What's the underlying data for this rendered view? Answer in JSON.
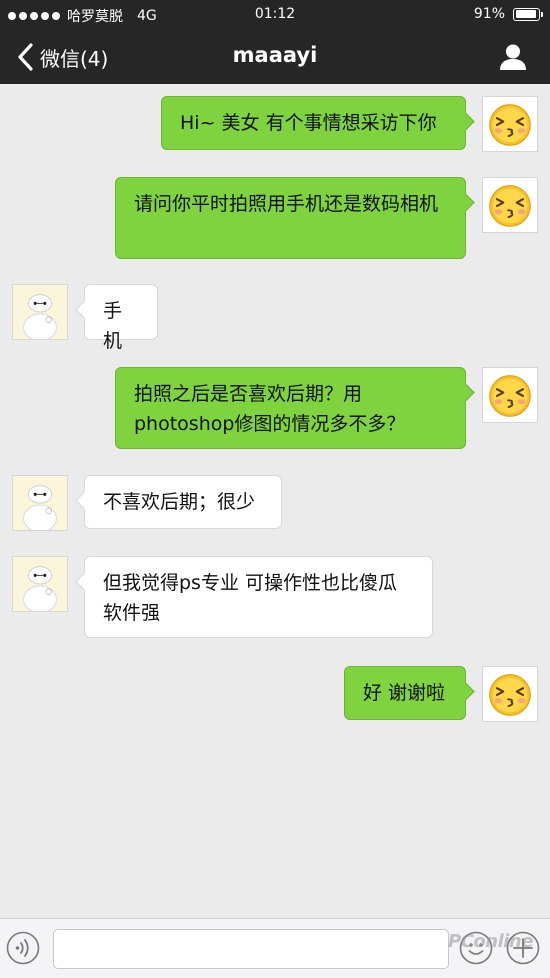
{
  "status_bar": {
    "carrier": "哈罗莫脱",
    "network": "4G",
    "time": "01:12",
    "battery_text": "91%",
    "battery_level": 0.91
  },
  "nav": {
    "back_label": "微信(4)",
    "title": "maaayi"
  },
  "messages": [
    {
      "side": "right",
      "text": "Hi~ 美女 有个事情想采访下你"
    },
    {
      "side": "right",
      "text": "请问你平时拍照用手机还是数码相机"
    },
    {
      "side": "left",
      "text": "手机"
    },
    {
      "side": "right",
      "text": "拍照之后是否喜欢后期？用photoshop修图的情况多不多？"
    },
    {
      "side": "left",
      "text": "不喜欢后期；很少"
    },
    {
      "side": "left",
      "text": "但我觉得ps专业 可操作性也比傻瓜软件强"
    },
    {
      "side": "right",
      "text": "好 谢谢啦"
    }
  ],
  "input": {
    "placeholder": ""
  },
  "watermark": "PConline",
  "colors": {
    "header_bg": "#262626",
    "chat_bg": "#ebebeb",
    "sent_bubble": "#7fd33e",
    "received_bubble": "#ffffff"
  },
  "icons": {
    "back": "chevron-left-icon",
    "profile": "person-icon",
    "voice": "voice-icon",
    "emoji": "emoji-icon",
    "plus": "plus-icon",
    "sender_avatar": "kiss-face-emoji",
    "receiver_avatar": "baymax"
  }
}
